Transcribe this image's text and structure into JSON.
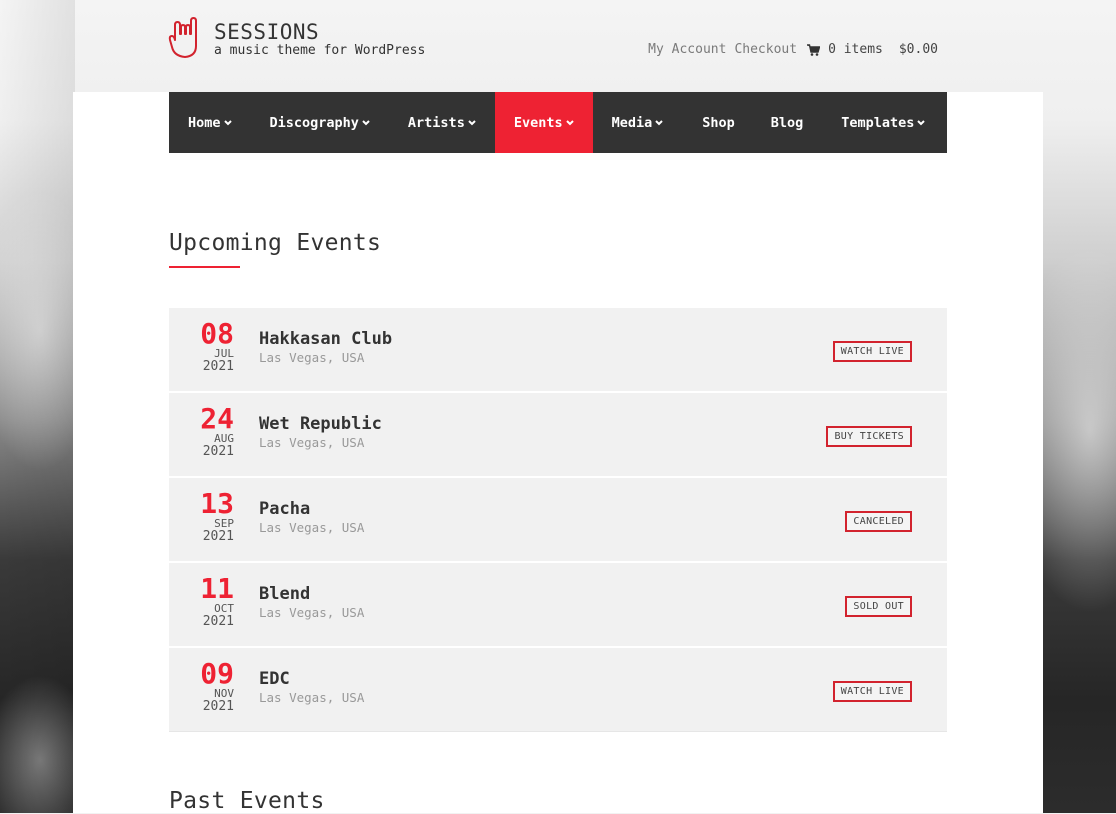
{
  "header": {
    "site_title": "SESSIONS",
    "tagline": "a music theme for WordPress",
    "logo_icon": "rock-hand-icon",
    "links": {
      "my_account": "My Account",
      "checkout": "Checkout",
      "cart_icon": "cart-icon",
      "cart_count": "0 items",
      "cart_total": "$0.00"
    }
  },
  "nav": {
    "items": [
      {
        "label": "Home",
        "has_dropdown": true,
        "active": false
      },
      {
        "label": "Discography",
        "has_dropdown": true,
        "active": false
      },
      {
        "label": "Artists",
        "has_dropdown": true,
        "active": false
      },
      {
        "label": "Events",
        "has_dropdown": true,
        "active": true
      },
      {
        "label": "Media",
        "has_dropdown": true,
        "active": false
      },
      {
        "label": "Shop",
        "has_dropdown": false,
        "active": false
      },
      {
        "label": "Blog",
        "has_dropdown": false,
        "active": false
      },
      {
        "label": "Templates",
        "has_dropdown": true,
        "active": false
      }
    ],
    "active_color": "#ee2233"
  },
  "upcoming": {
    "title": "Upcoming Events",
    "events": [
      {
        "day": "08",
        "month": "JUL",
        "year": "2021",
        "venue": "Hakkasan Club",
        "location": "Las Vegas, USA",
        "status": "WATCH LIVE"
      },
      {
        "day": "24",
        "month": "AUG",
        "year": "2021",
        "venue": "Wet Republic",
        "location": "Las Vegas, USA",
        "status": "BUY TICKETS"
      },
      {
        "day": "13",
        "month": "SEP",
        "year": "2021",
        "venue": "Pacha",
        "location": "Las Vegas, USA",
        "status": "CANCELED"
      },
      {
        "day": "11",
        "month": "OCT",
        "year": "2021",
        "venue": "Blend",
        "location": "Las Vegas, USA",
        "status": "SOLD OUT"
      },
      {
        "day": "09",
        "month": "NOV",
        "year": "2021",
        "venue": "EDC",
        "location": "Las Vegas, USA",
        "status": "WATCH LIVE"
      }
    ]
  },
  "past": {
    "title": "Past Events"
  },
  "colors": {
    "accent": "#ee2233",
    "nav_bg": "#333333",
    "event_bg": "#f1f1f1"
  }
}
